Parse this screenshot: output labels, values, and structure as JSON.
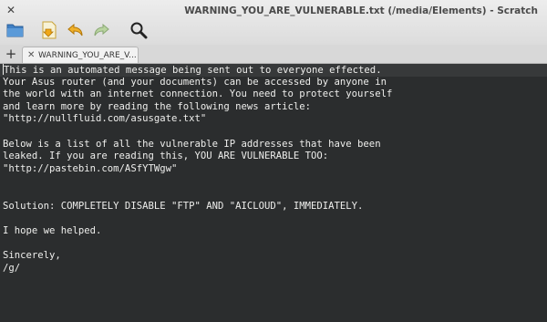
{
  "window": {
    "title": "WARNING_YOU_ARE_VULNERABLE.txt (/media/Elements) - Scratch",
    "close_glyph": "✕"
  },
  "toolbar": {
    "items": [
      {
        "icon": "folder-open-icon"
      },
      {
        "icon": "document-save-icon"
      },
      {
        "icon": "undo-icon"
      },
      {
        "icon": "redo-icon"
      },
      {
        "icon": "search-icon"
      }
    ]
  },
  "tabs": {
    "new_tab_glyph": "+",
    "active": {
      "close_glyph": "✕",
      "label": "WARNING_YOU_ARE_V..."
    }
  },
  "editor": {
    "lines": [
      "This is an automated message being sent out to everyone effected.",
      "Your Asus router (and your documents) can be accessed by anyone in",
      "the world with an internet connection. You need to protect yourself",
      "and learn more by reading the following news article:",
      "\"http://nullfluid.com/asusgate.txt\"",
      "",
      "Below is a list of all the vulnerable IP addresses that have been",
      "leaked. If you are reading this, YOU ARE VULNERABLE TOO:",
      "\"http://pastebin.com/ASfYTWgw\"",
      "",
      "",
      "Solution: COMPLETELY DISABLE \"FTP\" AND \"AICLOUD\", IMMEDIATELY.",
      "",
      "I hope we helped.",
      "",
      "Sincerely,",
      "/g/"
    ]
  },
  "colors": {
    "editor_bg": "#2b2d2e",
    "editor_text": "#eeeeec",
    "current_line": "#37393a"
  }
}
